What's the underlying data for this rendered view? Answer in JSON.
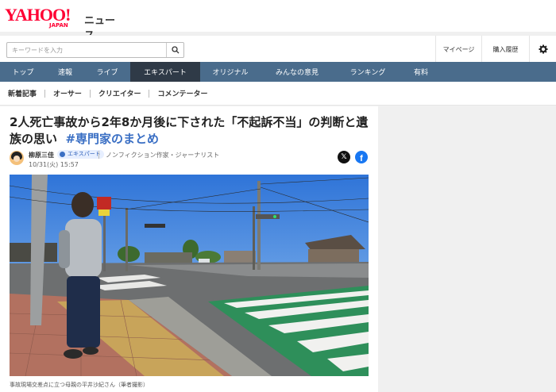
{
  "header": {
    "logo_main": "YAHOO!",
    "logo_sub": "JAPAN",
    "logo_section": "ニュース"
  },
  "search": {
    "placeholder": "キーワードを入力",
    "icon": "search-icon"
  },
  "utility": {
    "mypage": "マイページ",
    "history": "購入履歴",
    "settings_icon": "gear-icon"
  },
  "nav": {
    "items": [
      {
        "label": "トップ"
      },
      {
        "label": "速報"
      },
      {
        "label": "ライブ"
      },
      {
        "label": "エキスパート",
        "active": true
      },
      {
        "label": "オリジナル"
      },
      {
        "label": "みんなの意見"
      },
      {
        "label": "ランキング"
      },
      {
        "label": "有料"
      }
    ]
  },
  "subnav": {
    "items": [
      {
        "label": "新着記事"
      },
      {
        "label": "オーサー"
      },
      {
        "label": "クリエイター"
      },
      {
        "label": "コメンテーター"
      }
    ]
  },
  "article": {
    "title": "2人死亡事故から2年8か月後に下された「不起訴不当」の判断と遺族の思い",
    "tag": "#専門家のまとめ",
    "author": "柳原三佳",
    "badge": "エキスパート",
    "role": "ノンフィクション作家・ジャーナリスト",
    "date": "10/31(火) 15:57",
    "share": {
      "x": "𝕏",
      "facebook": "f"
    },
    "caption": "事故現場交差点に立つ母親の平井沙紀さん（筆者撮影）"
  },
  "colors": {
    "brand": "#ff0033",
    "nav_bg": "#4a6c8c",
    "nav_active": "#2f3a47",
    "tag": "#3a6fc4"
  }
}
